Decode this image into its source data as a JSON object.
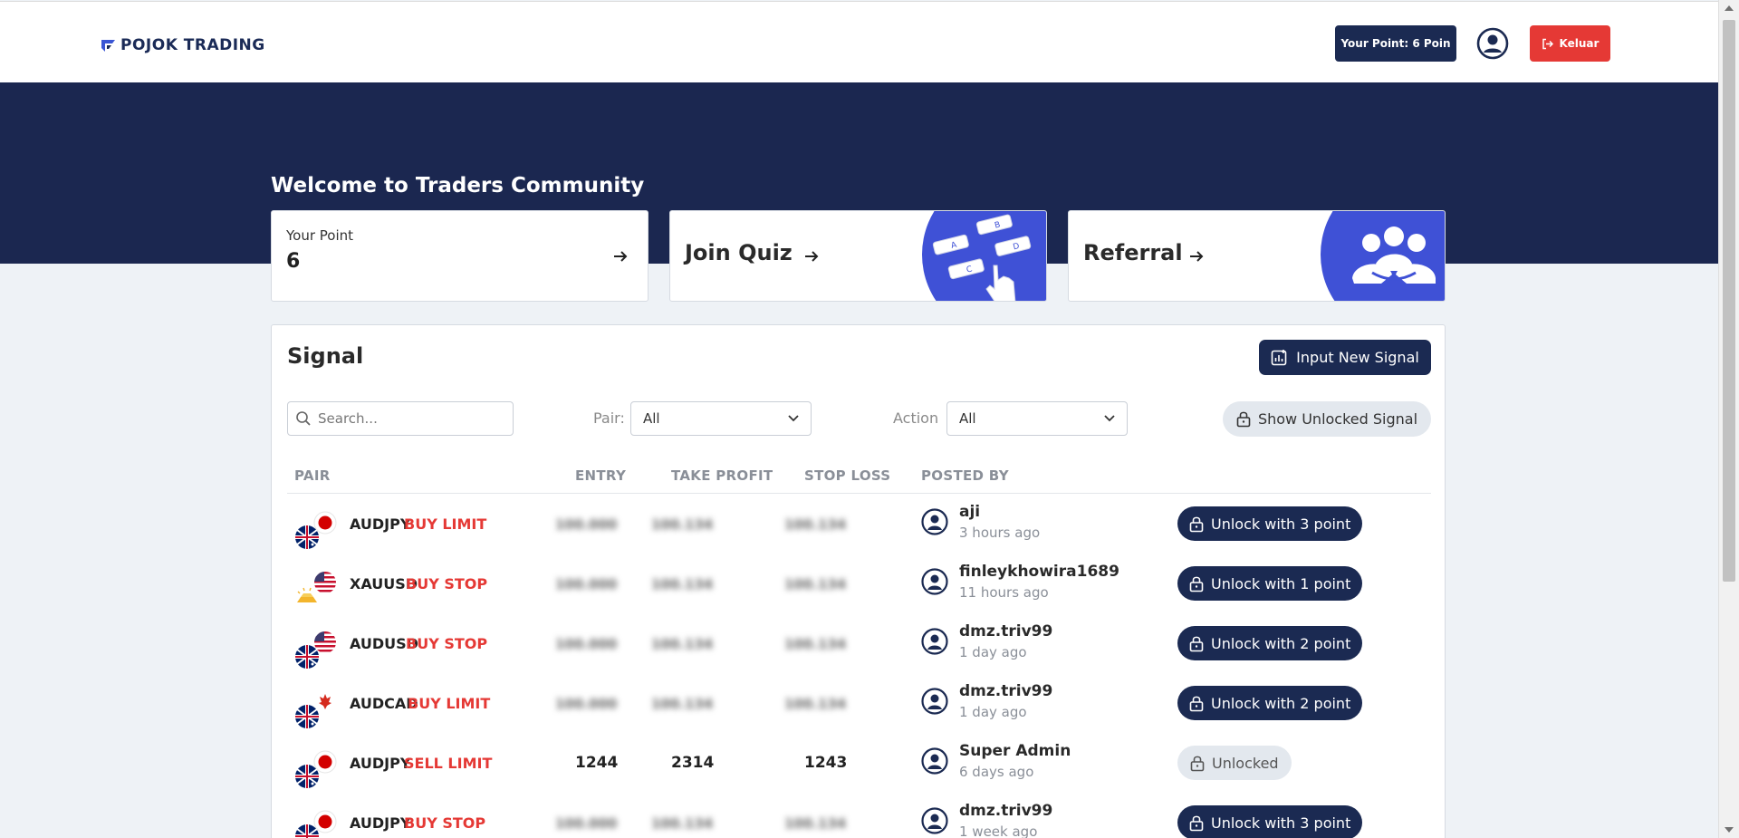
{
  "brand": {
    "name": "POJOK TRADING"
  },
  "header": {
    "points_badge": "Your Point: 6 Poin",
    "logout_label": "Keluar"
  },
  "hero": {
    "welcome": "Welcome to Traders Community"
  },
  "cards": {
    "point": {
      "label": "Your Point",
      "value": "6"
    },
    "quiz": {
      "title": "Join Quiz",
      "letters": [
        "A",
        "B",
        "C",
        "D"
      ]
    },
    "referral": {
      "title": "Referral"
    }
  },
  "signal": {
    "title": "Signal",
    "new_signal_label": "Input New Signal",
    "search_placeholder": "Search...",
    "pair_filter": {
      "label": "Pair:",
      "value": "All"
    },
    "action_filter": {
      "label": "Action",
      "value": "All"
    },
    "show_unlocked_label": "Show Unlocked Signal",
    "columns": [
      "PAIR",
      "ENTRY",
      "TAKE PROFIT",
      "STOP LOSS",
      "POSTED BY"
    ],
    "hidden_entry": "100.000",
    "hidden_price": "100.134",
    "rows": [
      {
        "pair": "AUDJPY",
        "action": "BUY LIMIT",
        "poster": "aji",
        "time": "3 hours ago",
        "button": "Unlock with 3 point",
        "locked": true
      },
      {
        "pair": "XAUUSD",
        "action": "BUY STOP",
        "poster": "finleykhowira1689",
        "time": "11 hours ago",
        "button": "Unlock with 1 point",
        "locked": true
      },
      {
        "pair": "AUDUSD",
        "action": "BUY STOP",
        "poster": "dmz.triv99",
        "time": "1 day ago",
        "button": "Unlock with 2 point",
        "locked": true
      },
      {
        "pair": "AUDCAD",
        "action": "BUY LIMIT",
        "poster": "dmz.triv99",
        "time": "1 day ago",
        "button": "Unlock with 2 point",
        "locked": true
      },
      {
        "pair": "AUDJPY",
        "action": "SELL LIMIT",
        "entry": "1244",
        "take_profit": "2314",
        "stop_loss": "1243",
        "poster": "Super Admin",
        "time": "6 days ago",
        "button": "Unlocked",
        "locked": false
      },
      {
        "pair": "AUDJPY",
        "action": "BUY STOP",
        "poster": "dmz.triv99",
        "time": "1 week ago",
        "button": "Unlock with 3 point",
        "locked": true
      }
    ]
  },
  "icons": {
    "logo": "logo-mark-icon",
    "profile": "user-circle-icon",
    "logout": "logout-icon",
    "arrow": "arrow-right-icon",
    "new_signal": "chart-plus-icon",
    "search": "search-icon",
    "chevron": "chevron-down-icon",
    "lock": "lock-icon"
  },
  "colors": {
    "navy": "#1b2a52",
    "hero": "#1b2750",
    "danger": "#e53935",
    "accent_art": "#3f51d6"
  }
}
